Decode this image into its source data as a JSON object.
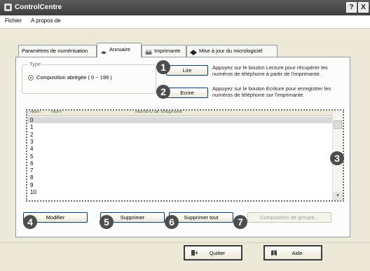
{
  "window": {
    "title": "ControlCentre",
    "help_label": "?",
    "close_label": "X"
  },
  "menu": {
    "items": [
      "Fichier",
      "A propos de"
    ]
  },
  "tabs": [
    {
      "label": "Paramètres de numérisation",
      "icon": "none"
    },
    {
      "label": "Annuaire",
      "icon": "phonebook-icon",
      "active": true
    },
    {
      "label": "Imprimante",
      "icon": "printer-icon"
    },
    {
      "label": "Mise à jour du micrologiciel",
      "icon": "firmware-icon"
    }
  ],
  "type_group": {
    "legend": "Type",
    "option_label": "Composition abrégée ( 0 ~ 199 )"
  },
  "actions": {
    "read_label": "Lire",
    "read_desc": "Appuyez sur le bouton Lecture pour récupérer les numéros de téléphone à partir de l'imprimante.",
    "write_label": "Ecrire",
    "write_desc": "Appuyez sur le bouton Ecriture pour enregistrer les numéros de téléphone sur l'imprimante."
  },
  "list": {
    "columns": [
      "Num",
      "Nom",
      "Numéro de téléphone"
    ],
    "rows": [
      "0",
      "1",
      "2",
      "3",
      "4",
      "5",
      "6",
      "7",
      "8",
      "9",
      "10"
    ]
  },
  "bottom_buttons": {
    "modify": "Modifier",
    "delete": "Supprimer",
    "delete_all": "Supprimer tout",
    "group_dial": "Composition de groupe..."
  },
  "footer": {
    "quit": "Quitter",
    "help": "Aide"
  },
  "callouts": [
    "1",
    "2",
    "3",
    "4",
    "5",
    "6",
    "7"
  ],
  "colors": {
    "accent": "#4d4d4d",
    "panel": "#fcfcfc",
    "window": "#ece9d8"
  }
}
